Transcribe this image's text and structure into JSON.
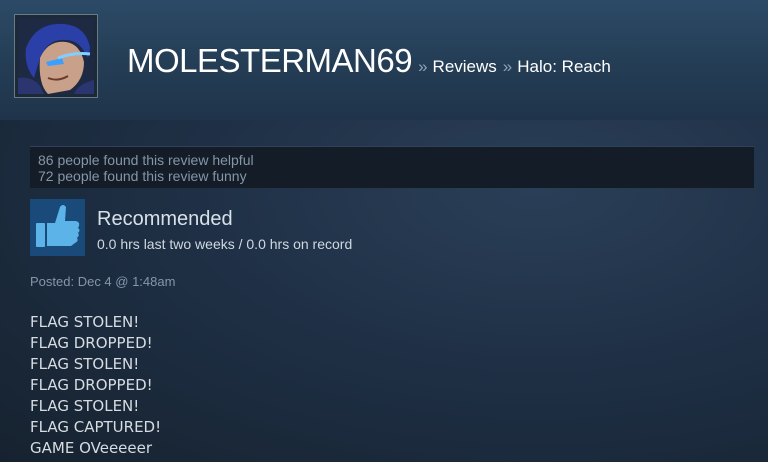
{
  "header": {
    "username": "MOLESTERMAN69",
    "separator": "»",
    "breadcrumb_reviews": "Reviews",
    "breadcrumb_game": "Halo: Reach",
    "avatar_icon": "user-avatar-icon"
  },
  "votes": {
    "helpful": "86 people found this review helpful",
    "funny": "72 people found this review funny"
  },
  "review": {
    "recommendation": "Recommended",
    "thumb_icon": "thumbs-up-icon",
    "hours": "0.0 hrs last two weeks / 0.0 hrs on record",
    "posted": "Posted: Dec 4 @ 1:48am",
    "lines": [
      "FLAG STOLEN!",
      "FLAG DROPPED!",
      "FLAG STOLEN!",
      "FLAG DROPPED!",
      "FLAG STOLEN!",
      "FLAG CAPTURED!",
      "GAME OVeeeeer"
    ]
  },
  "colors": {
    "header_bg": "#2c4a66",
    "page_bg": "#1b2838",
    "thumb_bg": "#1a4a7a",
    "thumb_fg": "#5bb3e8",
    "muted_text": "#8596a8"
  }
}
